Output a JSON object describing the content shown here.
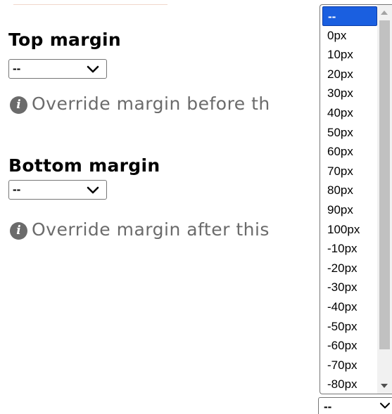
{
  "top_margin": {
    "label": "Top margin",
    "selected": "--",
    "help": "Override margin before th"
  },
  "bottom_margin": {
    "label": "Bottom margin",
    "selected": "--",
    "help": "Override margin after this"
  },
  "dropdown": {
    "options": [
      "--",
      "0px",
      "10px",
      "20px",
      "30px",
      "40px",
      "50px",
      "60px",
      "70px",
      "80px",
      "90px",
      "100px",
      "-10px",
      "-20px",
      "-30px",
      "-40px",
      "-50px",
      "-60px",
      "-70px",
      "-80px"
    ],
    "selected_index": 0,
    "highlight_color": "#1a5fe0"
  },
  "bottom_select": {
    "selected": "--"
  },
  "icons": {
    "info": "info-icon",
    "chevron": "chevron-down-icon",
    "scroll_up": "scroll-up-arrow-icon",
    "scroll_down": "scroll-down-arrow-icon"
  }
}
